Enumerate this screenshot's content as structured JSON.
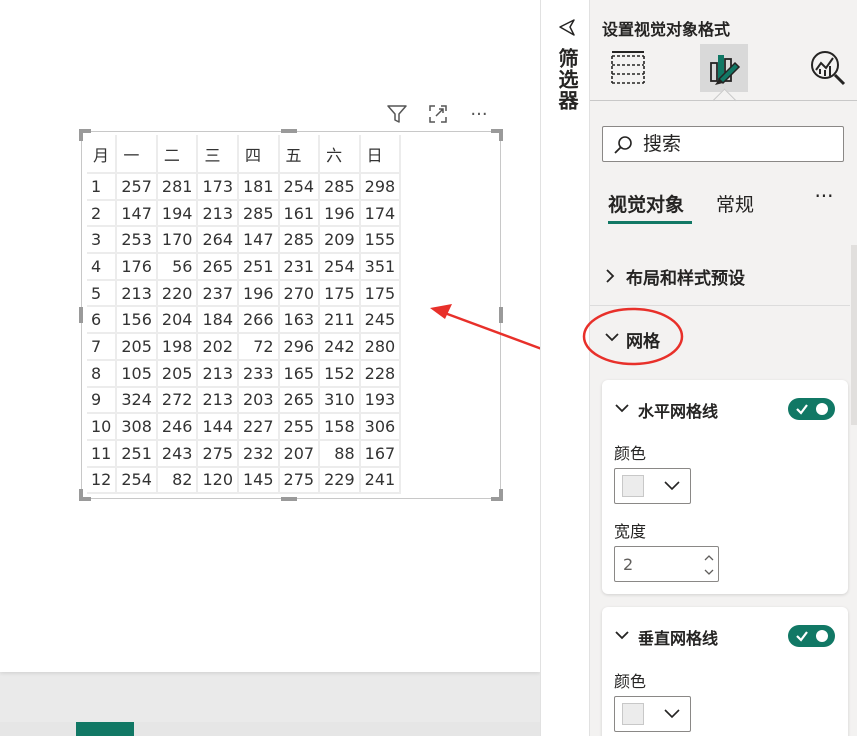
{
  "filters": {
    "label": "筛选器"
  },
  "format_pane": {
    "title": "设置视觉对象格式",
    "search": {
      "placeholder": "搜索",
      "value": ""
    },
    "tabs": [
      {
        "label": "视觉对象",
        "active": true
      },
      {
        "label": "常规",
        "active": false
      }
    ],
    "more_label": "···",
    "sections": [
      {
        "label": "布局和样式预设",
        "expanded": false
      },
      {
        "label": "网格",
        "expanded": true
      }
    ],
    "cards": [
      {
        "title": "水平网格线",
        "enabled": true,
        "color_label": "颜色",
        "color": "#ECECEC",
        "width_label": "宽度",
        "width_value": "2"
      },
      {
        "title": "垂直网格线",
        "enabled": true,
        "color_label": "颜色",
        "color": "#ECECEC"
      }
    ]
  },
  "visual_header": {
    "more_label": "···"
  },
  "matrix": {
    "headers": [
      "月",
      "一",
      "二",
      "三",
      "四",
      "五",
      "六",
      "日"
    ],
    "rows": [
      [
        "1",
        "257",
        "281",
        "173",
        "181",
        "254",
        "285",
        "298"
      ],
      [
        "2",
        "147",
        "194",
        "213",
        "285",
        "161",
        "196",
        "174"
      ],
      [
        "3",
        "253",
        "170",
        "264",
        "147",
        "285",
        "209",
        "155"
      ],
      [
        "4",
        "176",
        "56",
        "265",
        "251",
        "231",
        "254",
        "351"
      ],
      [
        "5",
        "213",
        "220",
        "237",
        "196",
        "270",
        "175",
        "175"
      ],
      [
        "6",
        "156",
        "204",
        "184",
        "266",
        "163",
        "211",
        "245"
      ],
      [
        "7",
        "205",
        "198",
        "202",
        "72",
        "296",
        "242",
        "280"
      ],
      [
        "8",
        "105",
        "205",
        "213",
        "233",
        "165",
        "152",
        "228"
      ],
      [
        "9",
        "324",
        "272",
        "213",
        "203",
        "265",
        "310",
        "193"
      ],
      [
        "10",
        "308",
        "246",
        "144",
        "227",
        "255",
        "158",
        "306"
      ],
      [
        "11",
        "251",
        "243",
        "275",
        "232",
        "207",
        "88",
        "167"
      ],
      [
        "12",
        "254",
        "82",
        "120",
        "145",
        "275",
        "229",
        "241"
      ]
    ]
  },
  "colors": {
    "accent": "#117865",
    "annotation": "#E8302A",
    "gridline": "#ECECEC"
  }
}
